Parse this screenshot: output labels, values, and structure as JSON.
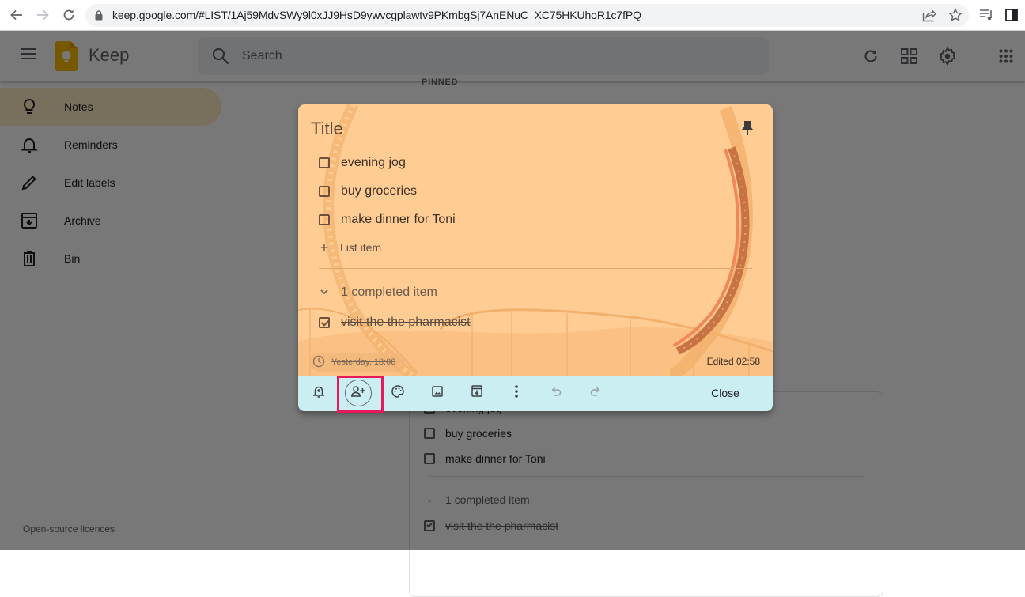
{
  "browser": {
    "url": "keep.google.com/#LIST/1Aj59MdvSWy9l0xJJ9HsD9ywvcgplawtv9PKmbgSj7AnENuC_XC75HKUhoR1c7fPQ",
    "icons": [
      "back-arrow-icon",
      "forward-arrow-icon",
      "reload-icon",
      "lock-icon",
      "share-icon",
      "star-icon",
      "reading-list-icon",
      "side-panel-icon"
    ]
  },
  "app": {
    "name": "Keep",
    "search": {
      "placeholder": "Search",
      "value": ""
    },
    "header_icons": [
      "refresh-icon",
      "grid-view-icon",
      "settings-icon",
      "apps-icon"
    ]
  },
  "sidebar": {
    "items": [
      {
        "label": "Notes",
        "icon": "lightbulb-icon",
        "active": true
      },
      {
        "label": "Reminders",
        "icon": "bell-icon",
        "active": false
      },
      {
        "label": "Edit labels",
        "icon": "pencil-icon",
        "active": false
      },
      {
        "label": "Archive",
        "icon": "archive-icon",
        "active": false
      },
      {
        "label": "Bin",
        "icon": "trash-icon",
        "active": false
      }
    ],
    "footer": "Open-source licences"
  },
  "main": {
    "section_label": "PINNED",
    "background_note": {
      "items": [
        {
          "text": "evening jog",
          "checked": false
        },
        {
          "text": "buy groceries",
          "checked": false
        },
        {
          "text": "make dinner for Toni",
          "checked": false
        }
      ],
      "completed_label": "1 completed item",
      "completed": [
        {
          "text": "visit the the pharmacist",
          "checked": true
        }
      ]
    }
  },
  "modal": {
    "title_placeholder": "Title",
    "pinned": true,
    "items": [
      {
        "text": "evening jog",
        "checked": false
      },
      {
        "text": "buy groceries",
        "checked": false
      },
      {
        "text": "make dinner for Toni",
        "checked": false
      }
    ],
    "add_item_label": "List item",
    "completed_label": "1 completed item",
    "completed": [
      {
        "text": "visit the the pharmacist",
        "checked": true
      }
    ],
    "reminder": "Yesterday, 18:00",
    "edited": "Edited 02:58",
    "background_color": "#ffcc94",
    "toolbar": {
      "buttons": [
        {
          "name": "remind-me",
          "icon": "bell-plus-icon"
        },
        {
          "name": "collaborator",
          "icon": "person-add-icon",
          "highlighted": true
        },
        {
          "name": "background-options",
          "icon": "palette-icon"
        },
        {
          "name": "add-image",
          "icon": "image-icon"
        },
        {
          "name": "archive",
          "icon": "archive-icon"
        },
        {
          "name": "more",
          "icon": "more-vert-icon"
        },
        {
          "name": "undo",
          "icon": "undo-icon",
          "disabled": true
        },
        {
          "name": "redo",
          "icon": "redo-icon",
          "disabled": true
        }
      ],
      "close_label": "Close"
    },
    "highlight_color": "#e8195b"
  }
}
